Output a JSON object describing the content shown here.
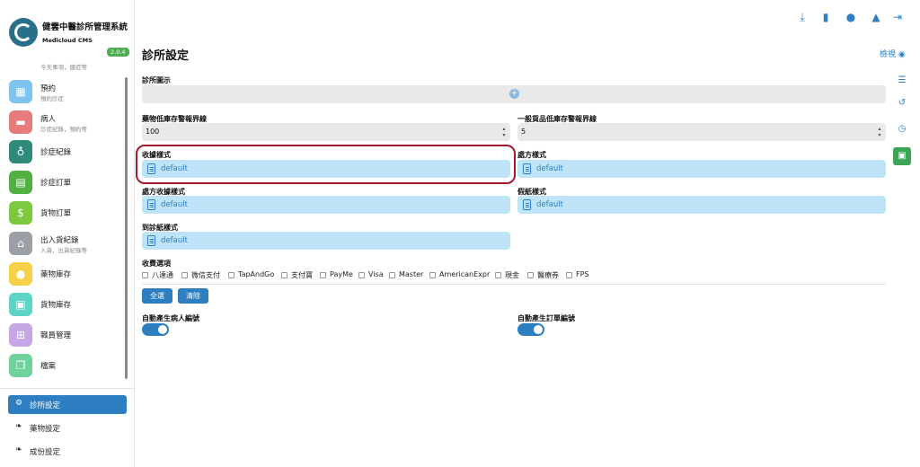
{
  "app": {
    "title": "健雲中醫診所管理系統",
    "subtitle": "Medicloud CMS",
    "version": "2.0.4"
  },
  "sidebar": {
    "partial_top_sub": "今天事項，健症等",
    "items": [
      {
        "label": "預約",
        "sub": "預約診症",
        "icon": "calendar-icon",
        "color": "#7fc4ee"
      },
      {
        "label": "病人",
        "sub": "診症紀錄，預約等",
        "icon": "bed-icon",
        "color": "#e87c7c"
      },
      {
        "label": "診症紀錄",
        "sub": "",
        "icon": "stethoscope-icon",
        "color": "#2f8a7a"
      },
      {
        "label": "診症訂單",
        "sub": "",
        "icon": "document-icon",
        "color": "#52b043"
      },
      {
        "label": "貨物訂單",
        "sub": "",
        "icon": "invoice-icon",
        "color": "#7cc940"
      },
      {
        "label": "出入貨紀錄",
        "sub": "入貨，出貨紀錄等",
        "icon": "warehouse-icon",
        "color": "#9aa0a6"
      },
      {
        "label": "藥物庫存",
        "sub": "",
        "icon": "pills-icon",
        "color": "#f5d04a"
      },
      {
        "label": "貨物庫存",
        "sub": "",
        "icon": "boxes-icon",
        "color": "#5fd3c4"
      },
      {
        "label": "職員管理",
        "sub": "",
        "icon": "org-chart-icon",
        "color": "#c7a6e6"
      },
      {
        "label": "檔案",
        "sub": "",
        "icon": "files-icon",
        "color": "#6fd19b"
      }
    ],
    "settings": [
      {
        "label": "診所設定",
        "active": true
      },
      {
        "label": "藥物設定",
        "active": false
      },
      {
        "label": "成份設定",
        "active": false
      }
    ]
  },
  "topbar": {
    "icons": [
      "download-icon",
      "clipboard-icon",
      "user-icon",
      "bell-icon",
      "logout-icon"
    ]
  },
  "page": {
    "title": "診所設定",
    "preview": "檢視"
  },
  "form": {
    "clinic_logo_label": "診所圖示",
    "drug_low_stock_label": "藥物低庫存警報界線",
    "drug_low_stock_value": "100",
    "goods_low_stock_label": "一般貨品低庫存警報界線",
    "goods_low_stock_value": "5",
    "receipt_style_label": "收據樣式",
    "receipt_style_value": "default",
    "prescription_style_label": "處方樣式",
    "prescription_style_value": "default",
    "prescription_receipt_style_label": "處方收據樣式",
    "prescription_receipt_style_value": "default",
    "leave_style_label": "假紙樣式",
    "leave_style_value": "default",
    "visit_style_label": "到診紙樣式",
    "visit_style_value": "default",
    "payment_label": "收費選項",
    "payment_options": [
      "八達通",
      "微信支付",
      "TapAndGo",
      "支付寶",
      "PayMe",
      "Visa",
      "Master",
      "AmericanExpr",
      "現金",
      "醫療券",
      "FPS"
    ],
    "select_all": "全選",
    "clear": "清除",
    "auto_patient_no_label": "自動產生病人編號",
    "auto_patient_no": true,
    "auto_order_no_label": "自動產生訂單編號",
    "auto_order_no": true
  },
  "colors": {
    "accent": "#2e7fc2",
    "highlight": "#a11c2b",
    "save": "#3aa655",
    "version_badge": "#4caf50"
  }
}
